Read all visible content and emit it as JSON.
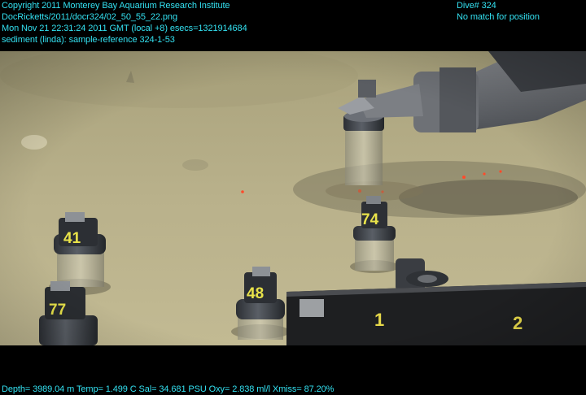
{
  "overlay": {
    "top_left": [
      "Copyright 2011 Monterey Bay Aquarium Research Institute",
      "DocRicketts/2011/docr324/02_50_55_22.png",
      "Mon Nov 21 22:31:24 2011 GMT (local +8)  esecs=1321914684",
      "sediment (linda): sample-reference 324-1-53"
    ],
    "top_right": [
      "Dive# 324",
      "No match for position"
    ],
    "bottom": "Depth= 3989.04 m  Temp= 1.499 C  Sal= 34.681 PSU  Oxy= 2.838 ml/l  Xmiss= 87.20%"
  },
  "scene": {
    "tube_labels": [
      "41",
      "77",
      "48",
      "74"
    ],
    "panel_labels": [
      "1",
      "2"
    ]
  },
  "colors": {
    "overlay_text": "#33e0f0",
    "sediment": "#b5ad86",
    "tube_label": "#e9e34a"
  }
}
